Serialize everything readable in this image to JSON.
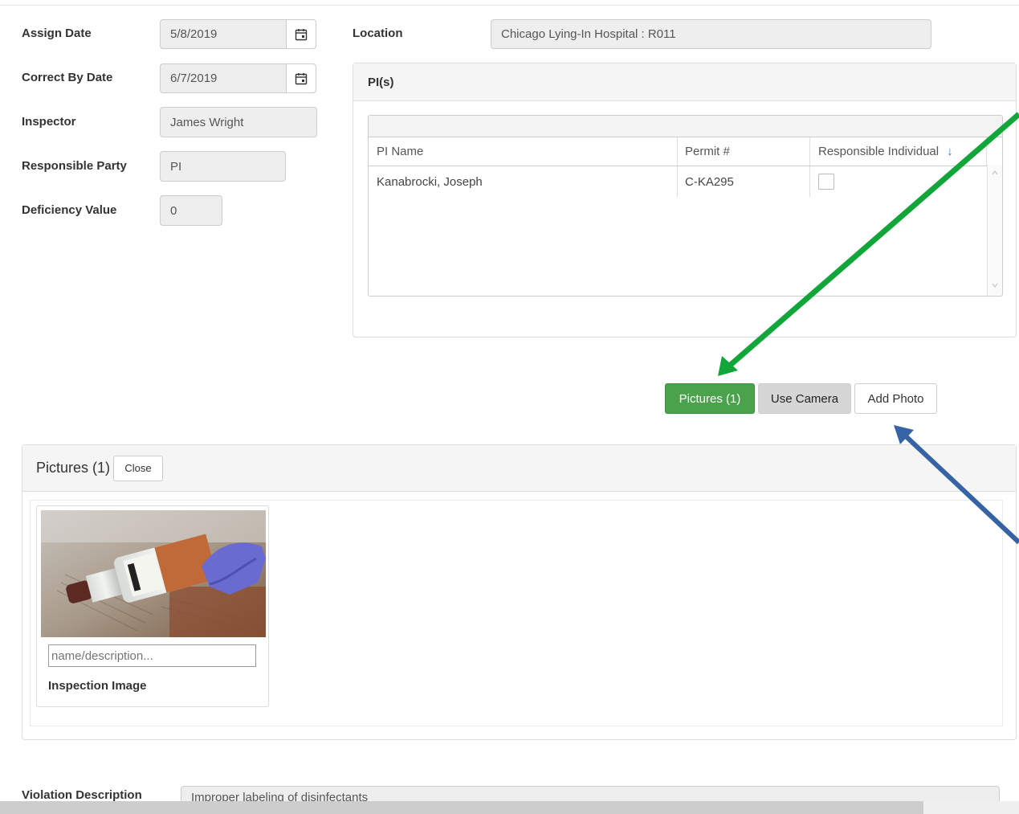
{
  "form": {
    "assign_date_label": "Assign Date",
    "assign_date_value": "5/8/2019",
    "correct_by_label": "Correct By Date",
    "correct_by_value": "6/7/2019",
    "inspector_label": "Inspector",
    "inspector_value": "James Wright",
    "responsible_party_label": "Responsible Party",
    "responsible_party_value": "PI",
    "deficiency_label": "Deficiency Value",
    "deficiency_value": "0",
    "location_label": "Location",
    "location_value": "Chicago Lying-In Hospital : R011"
  },
  "pis_panel": {
    "title": "PI(s)",
    "columns": [
      "PI Name",
      "Permit #",
      "Responsible Individual"
    ],
    "sort_indicator": "↓",
    "rows": [
      {
        "name": "Kanabrocki, Joseph",
        "permit": "C-KA295",
        "responsible": false
      }
    ]
  },
  "actions": {
    "pictures_label": "Pictures (1)",
    "use_camera_label": "Use Camera",
    "add_photo_label": "Add Photo"
  },
  "pictures_panel": {
    "title": "Pictures (1)",
    "close_label": "Close",
    "image": {
      "description_placeholder": "name/description...",
      "caption": "Inspection Image"
    }
  },
  "violation": {
    "label": "Violation Description",
    "value": "Improper labeling of disinfectants"
  },
  "colors": {
    "green_button": "#4aa34a",
    "arrow_green": "#12a63a",
    "arrow_blue": "#3563a4"
  }
}
